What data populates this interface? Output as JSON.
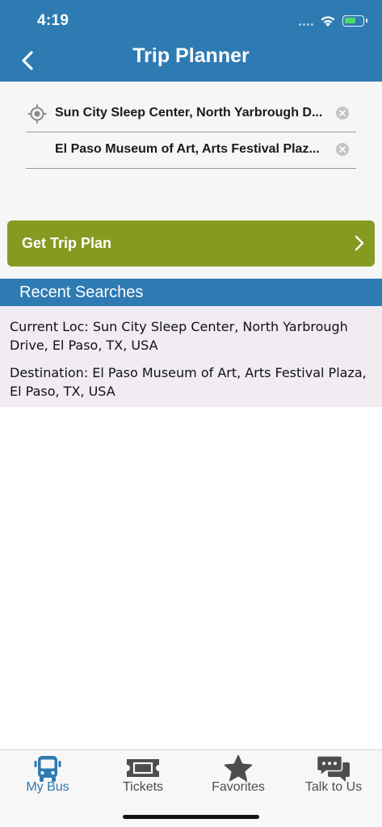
{
  "status_bar": {
    "time": "4:19"
  },
  "header": {
    "title": "Trip Planner"
  },
  "trip": {
    "origin": "Sun City Sleep Center, North Yarbrough D...",
    "destination": "El Paso Museum of Art, Arts Festival Plaz...",
    "plan_button_label": "Get Trip Plan"
  },
  "recent": {
    "title": "Recent Searches",
    "items": [
      "Current Loc: Sun City Sleep Center, North Yarbrough Drive, El Paso, TX, USA",
      "Destination: El Paso Museum of Art, Arts Festival Plaza, El Paso, TX, USA"
    ]
  },
  "tabs": [
    {
      "label": "My Bus",
      "icon": "bus-icon",
      "active": true
    },
    {
      "label": "Tickets",
      "icon": "ticket-icon",
      "active": false
    },
    {
      "label": "Favorites",
      "icon": "star-icon",
      "active": false
    },
    {
      "label": "Talk to Us",
      "icon": "chat-icon",
      "active": false
    }
  ],
  "colors": {
    "primary": "#2e7ab3",
    "button": "#869a22",
    "recent_bg": "#f0ecf2"
  }
}
